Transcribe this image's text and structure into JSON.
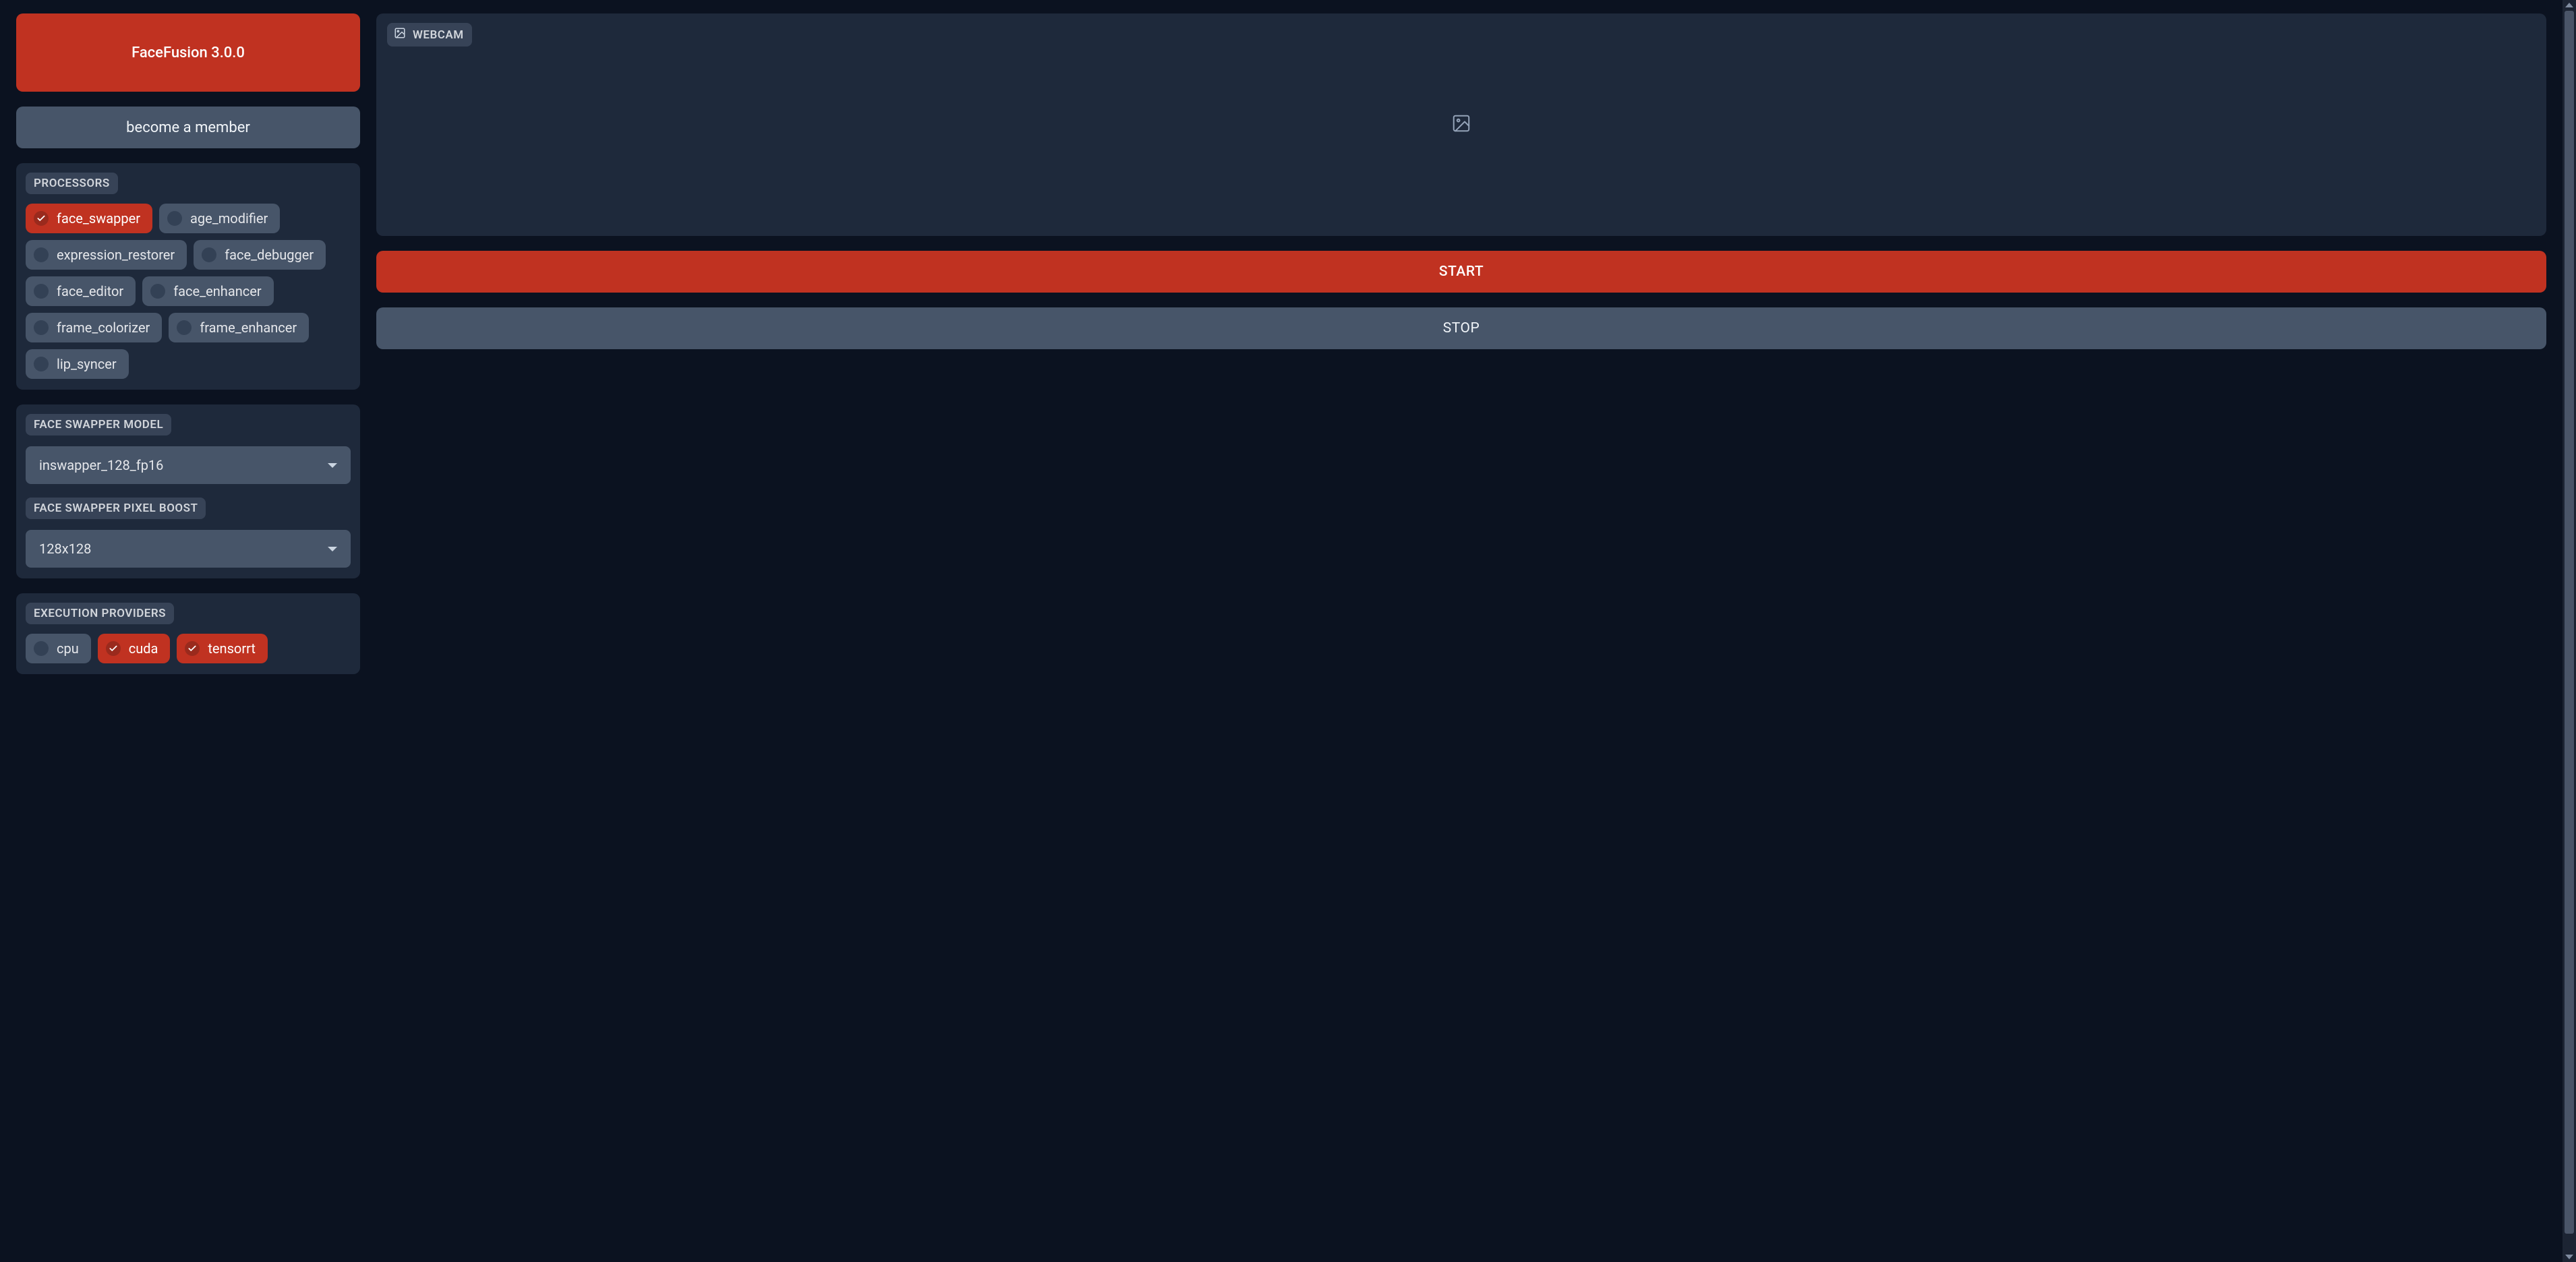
{
  "header": {
    "title": "FaceFusion 3.0.0",
    "member_label": "become a member"
  },
  "processors": {
    "label": "PROCESSORS",
    "items": [
      {
        "label": "face_swapper",
        "checked": true
      },
      {
        "label": "age_modifier",
        "checked": false
      },
      {
        "label": "expression_restorer",
        "checked": false
      },
      {
        "label": "face_debugger",
        "checked": false
      },
      {
        "label": "face_editor",
        "checked": false
      },
      {
        "label": "face_enhancer",
        "checked": false
      },
      {
        "label": "frame_colorizer",
        "checked": false
      },
      {
        "label": "frame_enhancer",
        "checked": false
      },
      {
        "label": "lip_syncer",
        "checked": false
      }
    ]
  },
  "swapper_model": {
    "label": "FACE SWAPPER MODEL",
    "value": "inswapper_128_fp16"
  },
  "pixel_boost": {
    "label": "FACE SWAPPER PIXEL BOOST",
    "value": "128x128"
  },
  "execution_providers": {
    "label": "EXECUTION PROVIDERS",
    "items": [
      {
        "label": "cpu",
        "checked": false
      },
      {
        "label": "cuda",
        "checked": true
      },
      {
        "label": "tensorrt",
        "checked": true
      }
    ]
  },
  "webcam": {
    "label": "WEBCAM"
  },
  "actions": {
    "start": "START",
    "stop": "STOP"
  },
  "colors": {
    "accent": "#c03221",
    "panel": "#1e293b",
    "chip": "#475569",
    "bg": "#0b1220"
  }
}
